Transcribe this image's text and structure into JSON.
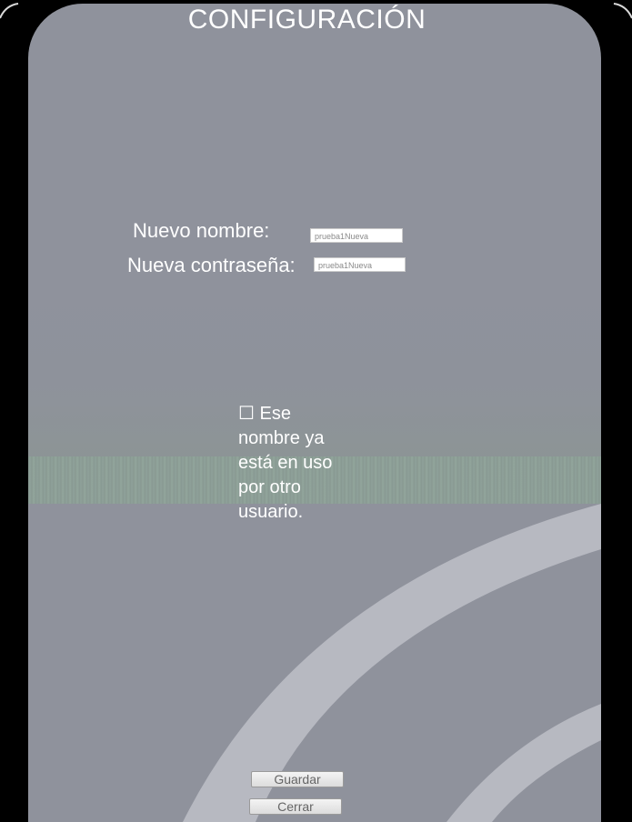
{
  "window": {
    "title": "CONFIGURACIÓN"
  },
  "form": {
    "name_label": "Nuevo nombre:",
    "name_value": "prueba1Nueva",
    "password_label": "Nueva contraseña:",
    "password_value": "prueba1Nueva",
    "error_checkbox": "☐",
    "error_text": "Ese nombre ya está en uso por otro usuario."
  },
  "buttons": {
    "save_label": "Guardar",
    "close_label": "Cerrar"
  },
  "colors": {
    "panel": "#8f929c",
    "arc": "#b7b9c1"
  }
}
